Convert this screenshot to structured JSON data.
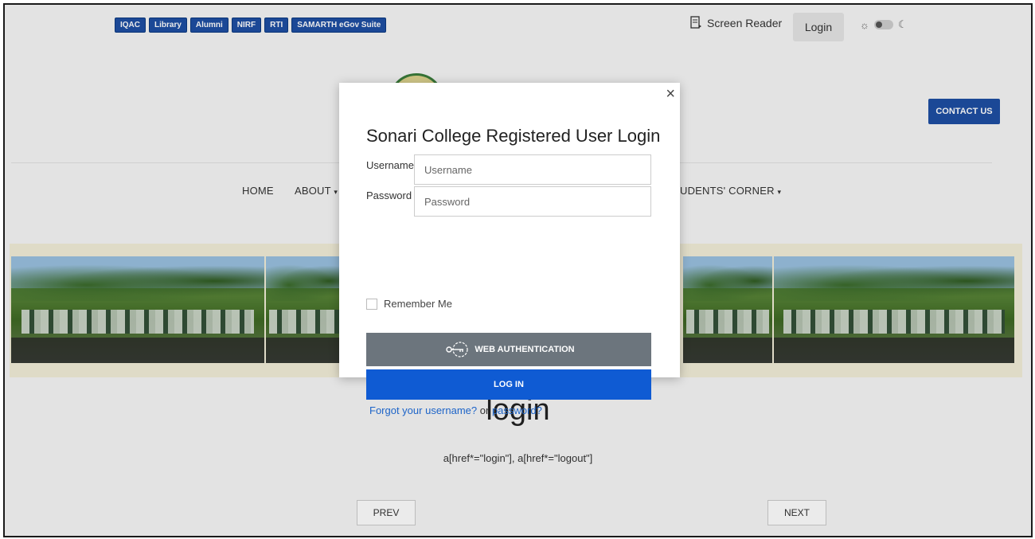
{
  "topbar": {
    "quick_links": [
      "IQAC",
      "Library",
      "Alumni",
      "NIRF",
      "RTI",
      "SAMARTH eGov Suite"
    ],
    "screen_reader_label": "Screen Reader",
    "login_label": "Login"
  },
  "header": {
    "contact_label": "CONTACT US"
  },
  "nav": {
    "home": "HOME",
    "about": "ABOUT",
    "students_corner": "UDENTS' CORNER"
  },
  "content": {
    "title": "login",
    "selector_text": "a[href*=\"login\"], a[href*=\"logout\"]",
    "prev_label": "PREV",
    "next_label": "NEXT"
  },
  "modal": {
    "title": "Sonari College Registered User Login",
    "username_label": "Username",
    "username_placeholder": "Username",
    "password_label": "Password",
    "password_placeholder": "Password",
    "remember_label": "Remember Me",
    "webauthn_label": "WEB AUTHENTICATION",
    "login_label": "LOG IN",
    "forgot_username": "Forgot your username?",
    "forgot_or": "or",
    "forgot_password": "password?",
    "close_glyph": "×"
  },
  "colors": {
    "brand_blue": "#1e4fa3",
    "login_blue": "#0f5bd3",
    "webauthn_gray": "#6c757d",
    "link_blue": "#1d64c8"
  }
}
